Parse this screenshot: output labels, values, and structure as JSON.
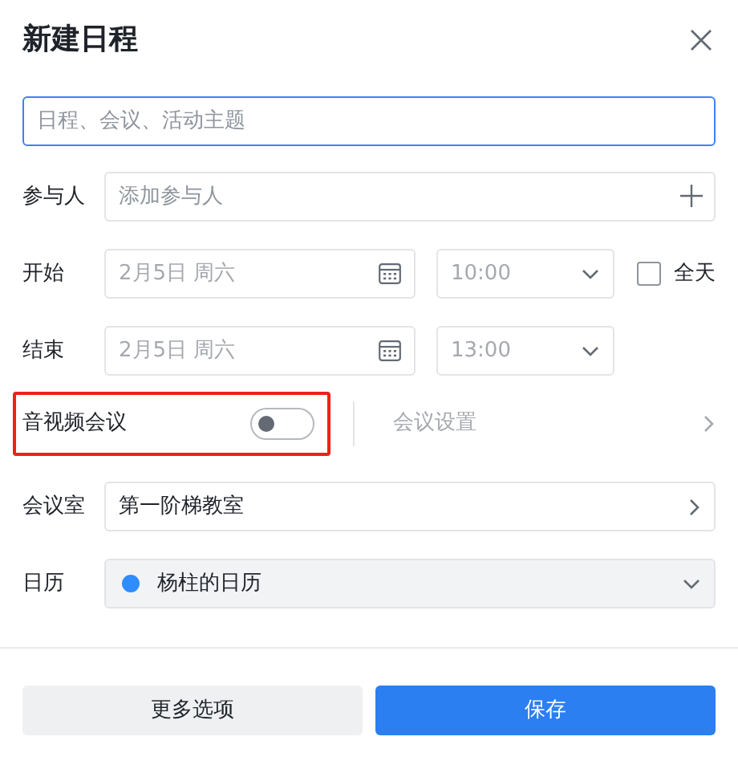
{
  "dialog": {
    "title": "新建日程",
    "subject": {
      "placeholder": "日程、会议、活动主题",
      "focused": true
    },
    "participants": {
      "label": "参与人",
      "placeholder": "添加参与人"
    },
    "start": {
      "label": "开始",
      "date": "2月5日 周六",
      "time": "10:00"
    },
    "all_day": {
      "label": "全天",
      "checked": false
    },
    "end": {
      "label": "结束",
      "date": "2月5日 周六",
      "time": "13:00"
    },
    "video_meeting": {
      "label": "音视频会议",
      "on": false,
      "highlighted": true
    },
    "meeting_settings": {
      "label": "会议设置",
      "disabled": true
    },
    "room": {
      "label": "会议室",
      "value": "第一阶梯教室"
    },
    "calendar": {
      "label": "日历",
      "value": "杨柱的日历",
      "color": "#2f8cff"
    },
    "buttons": [
      {
        "label": "更多选项",
        "kind": "secondary"
      },
      {
        "label": "保存",
        "kind": "primary"
      }
    ]
  }
}
